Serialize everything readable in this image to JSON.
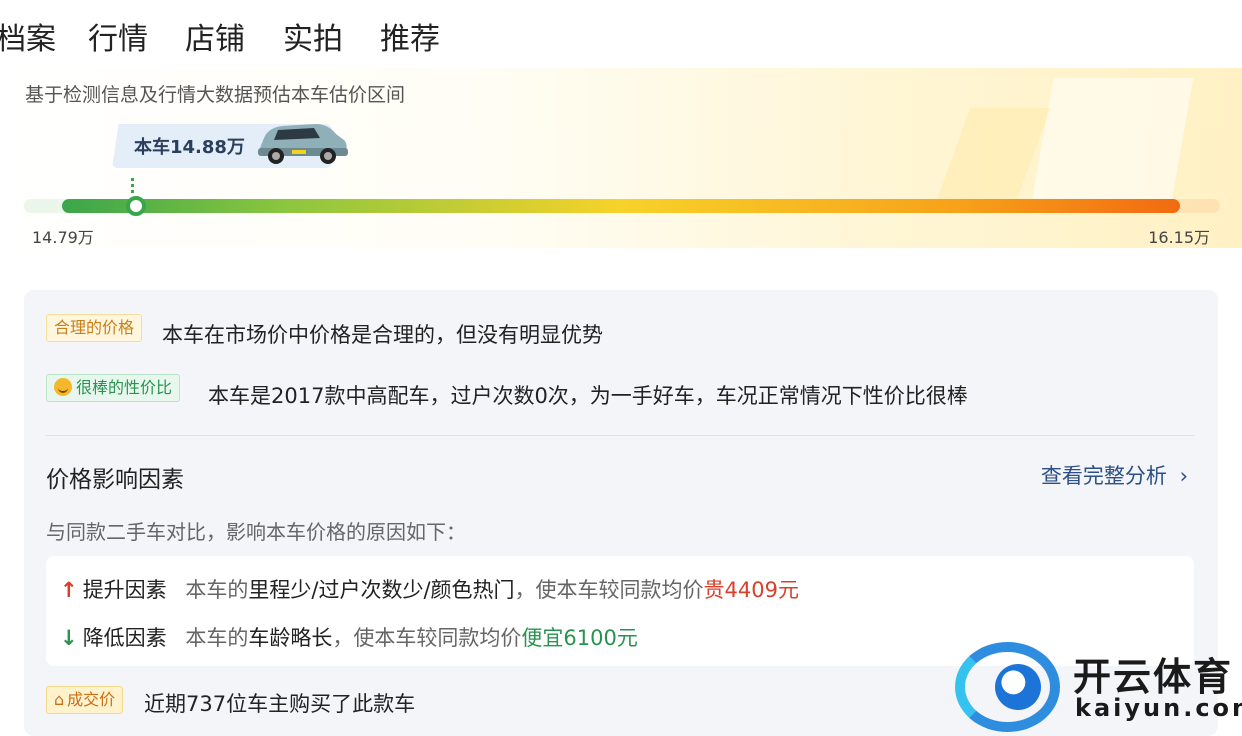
{
  "tabs": [
    {
      "label": "档案"
    },
    {
      "label": "行情",
      "active": true
    },
    {
      "label": "店铺"
    },
    {
      "label": "实拍"
    },
    {
      "label": "推荐"
    }
  ],
  "estimate": {
    "subtitle": "基于检测信息及行情大数据预估本车估价区间",
    "current_price_label": "本车14.88万",
    "min_label": "14.79万",
    "max_label": "16.15万",
    "min": 14.79,
    "max": 16.15,
    "current": 14.88
  },
  "assessment": {
    "price_tag": "合理的价格",
    "price_text": "本车在市场价中价格是合理的，但没有明显优势",
    "value_tag": "很棒的性价比",
    "value_text": "本车是2017款中高配车，过户次数0次，为一手好车，车况正常情况下性价比很棒"
  },
  "factors_section": {
    "title": "价格影响因素",
    "more_link": "查看完整分析",
    "intro": "与同款二手车对比，影响本车价格的原因如下：",
    "raise": {
      "label": "提升因素",
      "prefix": "本车的",
      "items": "里程少/过户次数少/颜色热门",
      "middle": "，使本车较同款均价",
      "result": "贵4409元"
    },
    "lower": {
      "label": "降低因素",
      "prefix": "本车的",
      "items": "车龄略长",
      "middle": "，使本车较同款均价",
      "result": "便宜6100元"
    }
  },
  "deal": {
    "tag": "成交价",
    "text": "近期737位车主购买了此款车"
  },
  "watermark": {
    "cn": "开云体育",
    "en": "kaiyun.com"
  },
  "colors": {
    "accent_green": "#3aa64a",
    "accent_red": "#d8402c",
    "link_blue": "#2c4f86"
  }
}
